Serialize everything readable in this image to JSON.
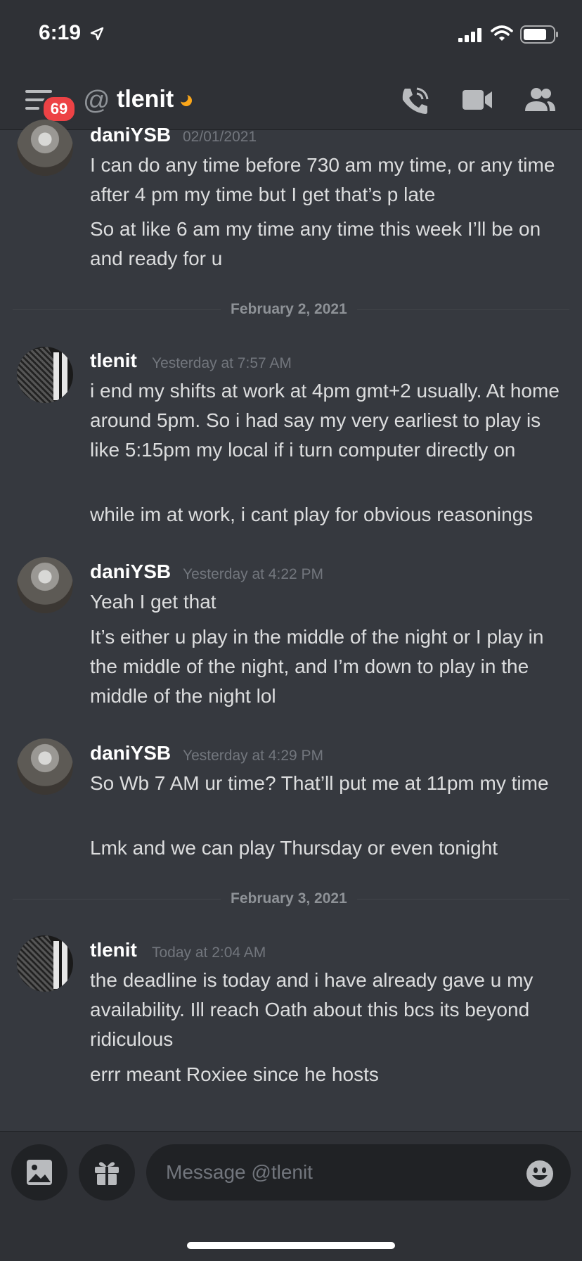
{
  "status_bar": {
    "time": "6:19"
  },
  "header": {
    "badge_count": "69",
    "at_symbol": "@",
    "title": "tlenit"
  },
  "dividers": [
    "February 2, 2021",
    "February 3, 2021"
  ],
  "messages": [
    {
      "author": "daniYSB",
      "timestamp": "02/01/2021",
      "lines": [
        "I can do any time before 730 am my time, or any time after 4 pm my time but I get that’s p late",
        "So at like 6 am my time any time this week I’ll be on and ready for u"
      ]
    },
    {
      "author": "tlenit",
      "timestamp": "Yesterday at 7:57 AM",
      "lines": [
        "i end my shifts at work at 4pm gmt+2 usually. At home around 5pm. So i had say my very earliest to play is like 5:15pm my local if i turn computer directly on",
        "while im at work, i cant play for obvious reasonings"
      ]
    },
    {
      "author": "daniYSB",
      "timestamp": "Yesterday at 4:22 PM",
      "lines": [
        "Yeah I get that",
        "It’s either u play in the middle of the night or I play in the middle of the night, and I’m down to play in the middle of the night lol"
      ]
    },
    {
      "author": "daniYSB",
      "timestamp": "Yesterday at 4:29 PM",
      "lines": [
        "So Wb 7 AM ur time? That’ll put me at 11pm my time",
        "Lmk and we can play Thursday or even tonight"
      ]
    },
    {
      "author": "tlenit",
      "timestamp": "Today at 2:04 AM",
      "lines": [
        "the deadline is today and i have already gave u my availability. Ill reach Oath about this bcs its beyond ridiculous",
        "errr meant Roxiee since he hosts"
      ]
    }
  ],
  "composer": {
    "placeholder": "Message @tlenit"
  },
  "colors": {
    "background": "#36393f",
    "header": "#2f3136",
    "badge": "#ed4245",
    "idle_status": "#faa61a"
  }
}
